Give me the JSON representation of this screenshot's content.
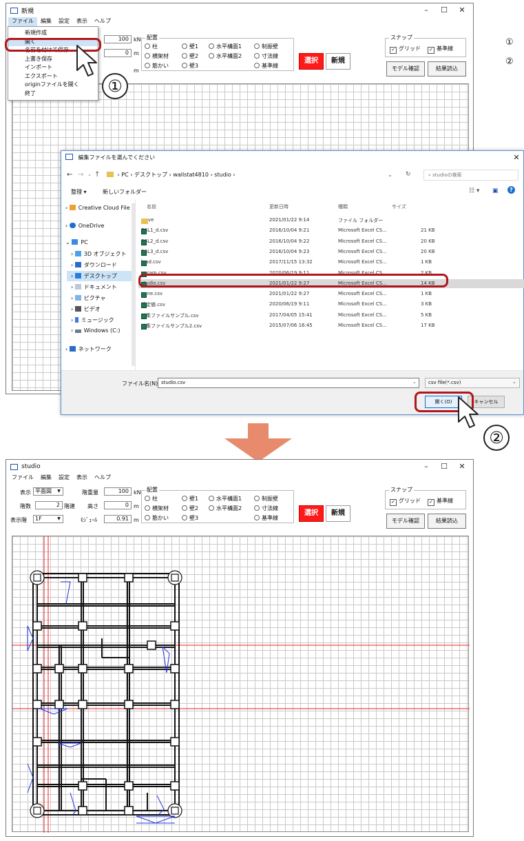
{
  "legend": {
    "step1": "①",
    "step2": "②"
  },
  "top_window": {
    "title": "新規",
    "menu": [
      "ファイル",
      "編集",
      "設定",
      "表示",
      "ヘルプ"
    ],
    "floor_load_value": "100",
    "floor_load_unit": "kN",
    "height_value": "0",
    "height_unit": "m",
    "module_unit": "m"
  },
  "file_menu": {
    "items": [
      "新規作成",
      "開く",
      "名前を付けて保存",
      "上書き保存",
      "インポート",
      "エクスポート",
      "originファイルを開く",
      "終了"
    ]
  },
  "toolbar": {
    "placement_group": "配置",
    "radios": [
      [
        "柱",
        "壁1",
        "水平構面1",
        "制振壁"
      ],
      [
        "横架材",
        "壁2",
        "水平構面2",
        "寸法線"
      ],
      [
        "筋かい",
        "壁3",
        "",
        "基準線"
      ]
    ],
    "select_button": "選択",
    "new_button": "新規",
    "snap_group": "スナップ",
    "grid_label": "グリッド",
    "baseline_label": "基準線",
    "model_check_button": "モデル確認",
    "result_load_button": "結果読込"
  },
  "dialog": {
    "title": "編集ファイルを選んでください",
    "breadcrumb": [
      "PC",
      "デスクトップ",
      "wallstat4810",
      "studio"
    ],
    "search_placeholder": "studioの検索",
    "organize": "整理 ▾",
    "new_folder": "新しいフォルダー",
    "nav": [
      "Creative Cloud File",
      "OneDrive",
      "PC",
      "3D オブジェクト",
      "ダウンロード",
      "デスクトップ",
      "ドキュメント",
      "ピクチャ",
      "ビデオ",
      "ミュージック",
      "Windows (C:)",
      "ネットワーク"
    ],
    "columns": [
      "名前",
      "更新日時",
      "種類",
      "サイズ"
    ],
    "files": [
      {
        "name": "wave",
        "date": "2021/01/22 9:14",
        "type": "ファイル フォルダー",
        "size": "",
        "folder": true
      },
      {
        "name": "BSL1_d.csv",
        "date": "2016/10/04 9:21",
        "type": "Microsoft Excel CS...",
        "size": "21 KB"
      },
      {
        "name": "BSL2_d.csv",
        "date": "2016/10/04 9:22",
        "type": "Microsoft Excel CS...",
        "size": "20 KB"
      },
      {
        "name": "BSL3_d.csv",
        "date": "2016/10/04 9:23",
        "type": "Microsoft Excel CS...",
        "size": "20 KB"
      },
      {
        "name": "load.csv",
        "date": "2017/11/15 13:32",
        "type": "Microsoft Excel CS...",
        "size": "1 KB"
      },
      {
        "name": "param.csv",
        "date": "2020/06/19 9:11",
        "type": "Microsoft Excel CS...",
        "size": "2 KB"
      },
      {
        "name": "studio.csv",
        "date": "2021/01/22 9:27",
        "type": "Microsoft Excel CS...",
        "size": "14 KB"
      },
      {
        "name": "yane.csv",
        "date": "2021/01/22 9:27",
        "type": "Microsoft Excel CS...",
        "size": "1 KB"
      },
      {
        "name": "設定値.csv",
        "date": "2020/06/19 9:11",
        "type": "Microsoft Excel CS...",
        "size": "3 KB"
      },
      {
        "name": "編集ファイルサンプル.csv",
        "date": "2017/04/05 15:41",
        "type": "Microsoft Excel CS...",
        "size": "5 KB"
      },
      {
        "name": "編集ファイルサンプル2.csv",
        "date": "2015/07/06 16:45",
        "type": "Microsoft Excel CS...",
        "size": "17 KB"
      }
    ],
    "filename_label": "ファイル名(N):",
    "filename_value": "studio.csv",
    "filetype": "csv file(*.csv)",
    "open_button": "開く(O)",
    "cancel_button": "キャンセル"
  },
  "bottom_window": {
    "title": "studio",
    "menu": [
      "ファイル",
      "編集",
      "設定",
      "表示",
      "ヘルプ"
    ],
    "view_label": "表示",
    "view_value": "平面図",
    "floors_label": "階数",
    "floors_value": "2",
    "floors_unit": "階建",
    "display_floor_label": "表示階",
    "display_floor_value": "1F",
    "floor_load_label": "階重量",
    "floor_load_value": "100",
    "floor_load_unit": "kN",
    "height_label": "高さ",
    "height_value": "0",
    "height_unit": "m",
    "module_label": "ﾓｼﾞｭｰﾙ",
    "module_value": "0.91",
    "module_unit": "m"
  },
  "colors": {
    "accent_red": "#b0161c",
    "select_red": "#ff1a1a",
    "arrow": "#e88a6c",
    "guide_red": "#e22",
    "wall_blue": "#2233dd"
  }
}
